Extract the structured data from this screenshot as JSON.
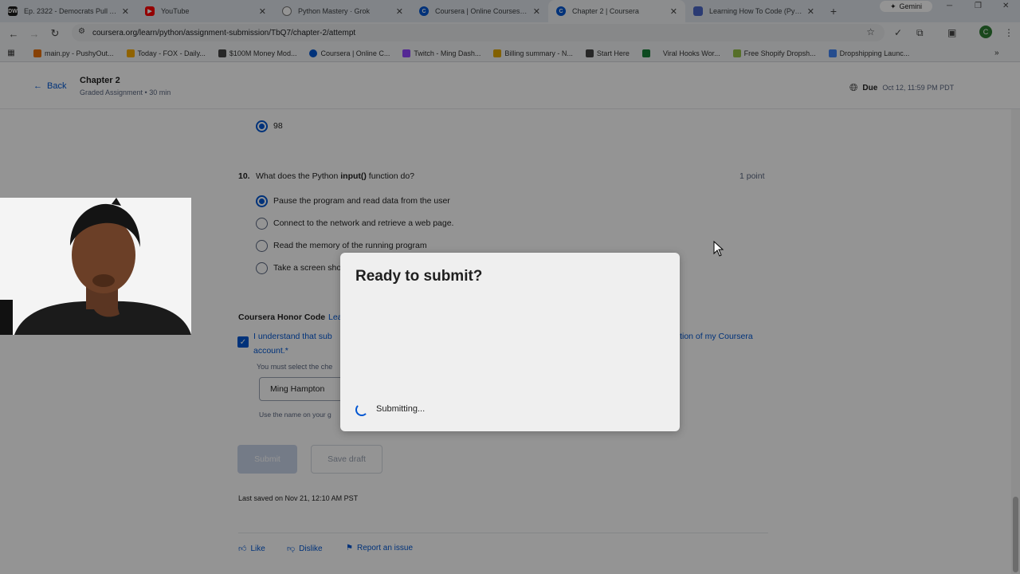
{
  "browser": {
    "tabs": [
      {
        "title": "Ep. 2322 - Democrats Pull Aft...",
        "favicon": "DW",
        "color": "#1a1a1a"
      },
      {
        "title": "YouTube",
        "favicon": "",
        "color": "#ff0000"
      },
      {
        "title": "Python Mastery · Grok",
        "favicon": "",
        "color": "#777777"
      },
      {
        "title": "Coursera | Online Courses Fr...",
        "favicon": "C",
        "color": "#0056d2"
      },
      {
        "title": "Chapter 2 | Coursera",
        "favicon": "C",
        "color": "#0056d2",
        "active": true
      },
      {
        "title": "Learning How To Code (Pyth...",
        "favicon": "",
        "color": "#4a67c7"
      }
    ],
    "gemini_label": "Gemini",
    "url": "coursera.org/learn/python/assignment-submission/TbQ7/chapter-2/attempt",
    "profile_initial": "C",
    "bookmarks": [
      {
        "label": "main.py - PushyOut...",
        "color": "#e8710a"
      },
      {
        "label": "Today - FOX - Daily...",
        "color": "#f9ab00"
      },
      {
        "label": "$100M Money Mod...",
        "color": "#444444"
      },
      {
        "label": "Coursera | Online C...",
        "color": "#0056d2"
      },
      {
        "label": "Twitch - Ming Dash...",
        "color": "#9146ff"
      },
      {
        "label": "Billing summary - N...",
        "color": "#e0a800"
      },
      {
        "label": "Start Here",
        "color": "#444444"
      },
      {
        "label": "",
        "color": "#188038"
      },
      {
        "label": "Viral Hooks Wor...",
        "color": "#444444"
      },
      {
        "label": "Free Shopify Dropsh...",
        "color": "#95bf47"
      },
      {
        "label": "Dropshipping Launc...",
        "color": "#4285f4"
      }
    ]
  },
  "header": {
    "back_label": "Back",
    "title": "Chapter 2",
    "subtitle": "Graded Assignment • 30 min",
    "due_label": "Due",
    "due_date": "Oct 12, 11:59 PM PDT"
  },
  "prev_question": {
    "selected_option": "98"
  },
  "question": {
    "number": "10.",
    "text_before": "What does the Python ",
    "text_bold": "input()",
    "text_after": " function do?",
    "points": "1 point",
    "options": [
      {
        "label": "Pause the program and read data from the user",
        "selected": true
      },
      {
        "label": "Connect to the network and retrieve a web page.",
        "selected": false
      },
      {
        "label": "Read the memory of the running program",
        "selected": false
      },
      {
        "label": "Take a screen sho",
        "selected": false
      }
    ]
  },
  "honor": {
    "heading": "Coursera Honor Code",
    "link": "Lea",
    "text_line1": "I understand that sub",
    "text_line1_tail": "vation of my Coursera",
    "text_line2": "account.*",
    "must_select": "You must select the che",
    "name_value": "Ming Hampton",
    "use_name": "Use the name on your g"
  },
  "actions": {
    "submit_label": "Submit",
    "draft_label": "Save draft"
  },
  "last_saved": "Last saved on Nov 21, 12:10 AM PST",
  "feedback": {
    "like": "Like",
    "dislike": "Dislike",
    "report": "Report an issue"
  },
  "modal": {
    "title": "Ready to submit?",
    "status": "Submitting..."
  }
}
